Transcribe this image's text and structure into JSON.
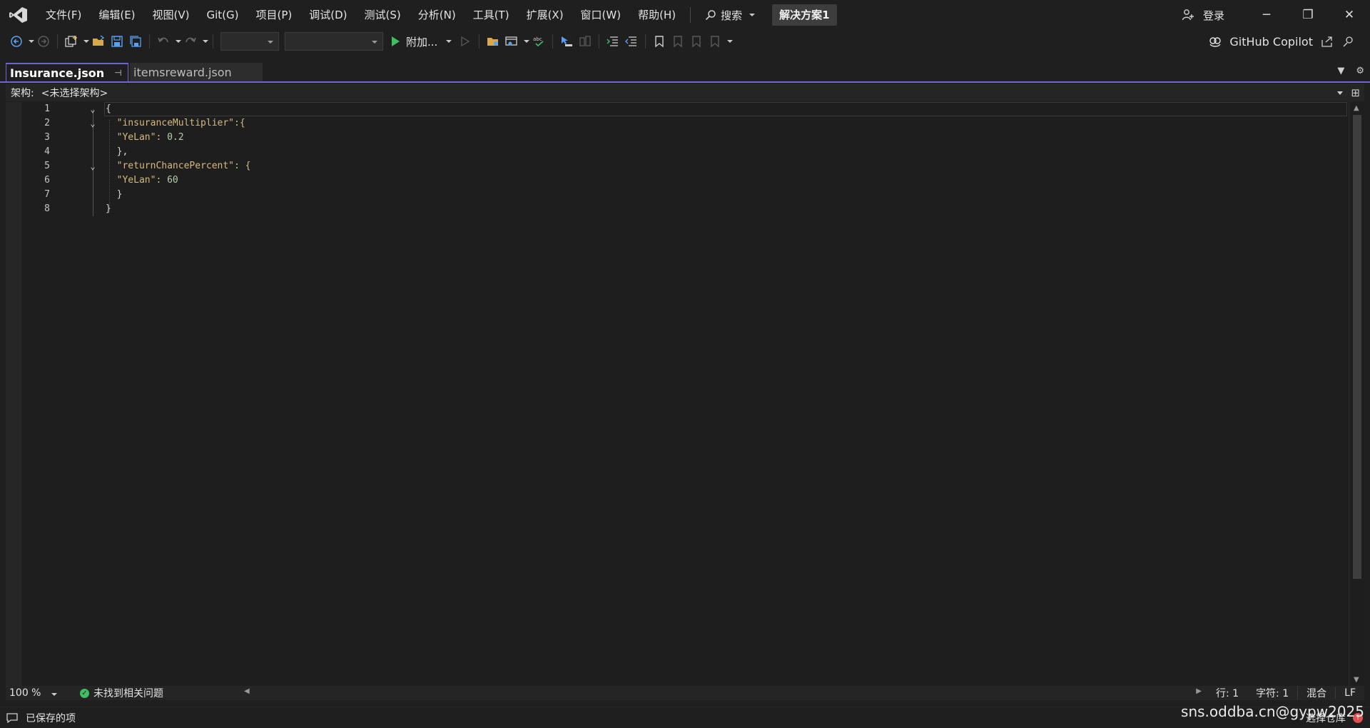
{
  "menu": {
    "items": [
      "文件(F)",
      "编辑(E)",
      "视图(V)",
      "Git(G)",
      "项目(P)",
      "调试(D)",
      "测试(S)",
      "分析(N)",
      "工具(T)",
      "扩展(X)",
      "窗口(W)",
      "帮助(H)"
    ],
    "search_label": "搜索",
    "solution_name": "解决方案1",
    "login_label": "登录"
  },
  "toolbar": {
    "run_label": "附加...",
    "copilot_label": "GitHub Copilot"
  },
  "tabs": [
    {
      "label": "Insurance.json",
      "active": true
    },
    {
      "label": "itemsreward.json",
      "active": false
    }
  ],
  "schema": {
    "label": "架构:",
    "value": "<未选择架构>"
  },
  "editor": {
    "lines": [
      {
        "n": "1",
        "text": "{"
      },
      {
        "n": "2",
        "text": "  \"insuranceMultiplier\":{"
      },
      {
        "n": "3",
        "text": "  \"YeLan\": 0.2"
      },
      {
        "n": "4",
        "text": "  },"
      },
      {
        "n": "5",
        "text": "  \"returnChancePercent\": {"
      },
      {
        "n": "6",
        "text": "  \"YeLan\": 60"
      },
      {
        "n": "7",
        "text": "  }"
      },
      {
        "n": "8",
        "text": "}"
      }
    ]
  },
  "editor_status": {
    "zoom": "100 %",
    "issues": "未找到相关问题",
    "line": "行: 1",
    "char": "字符: 1",
    "mode": "混合",
    "eol": "LF"
  },
  "status": {
    "saved": "已保存的项",
    "watermark": "sns.oddba.cn@gypw2025",
    "repo_label": "选择仓库"
  },
  "colors": {
    "accent": "#6e66c8",
    "run_green": "#3fbf5f",
    "json_key": "#d7ba7d",
    "json_number": "#b5cea8"
  }
}
